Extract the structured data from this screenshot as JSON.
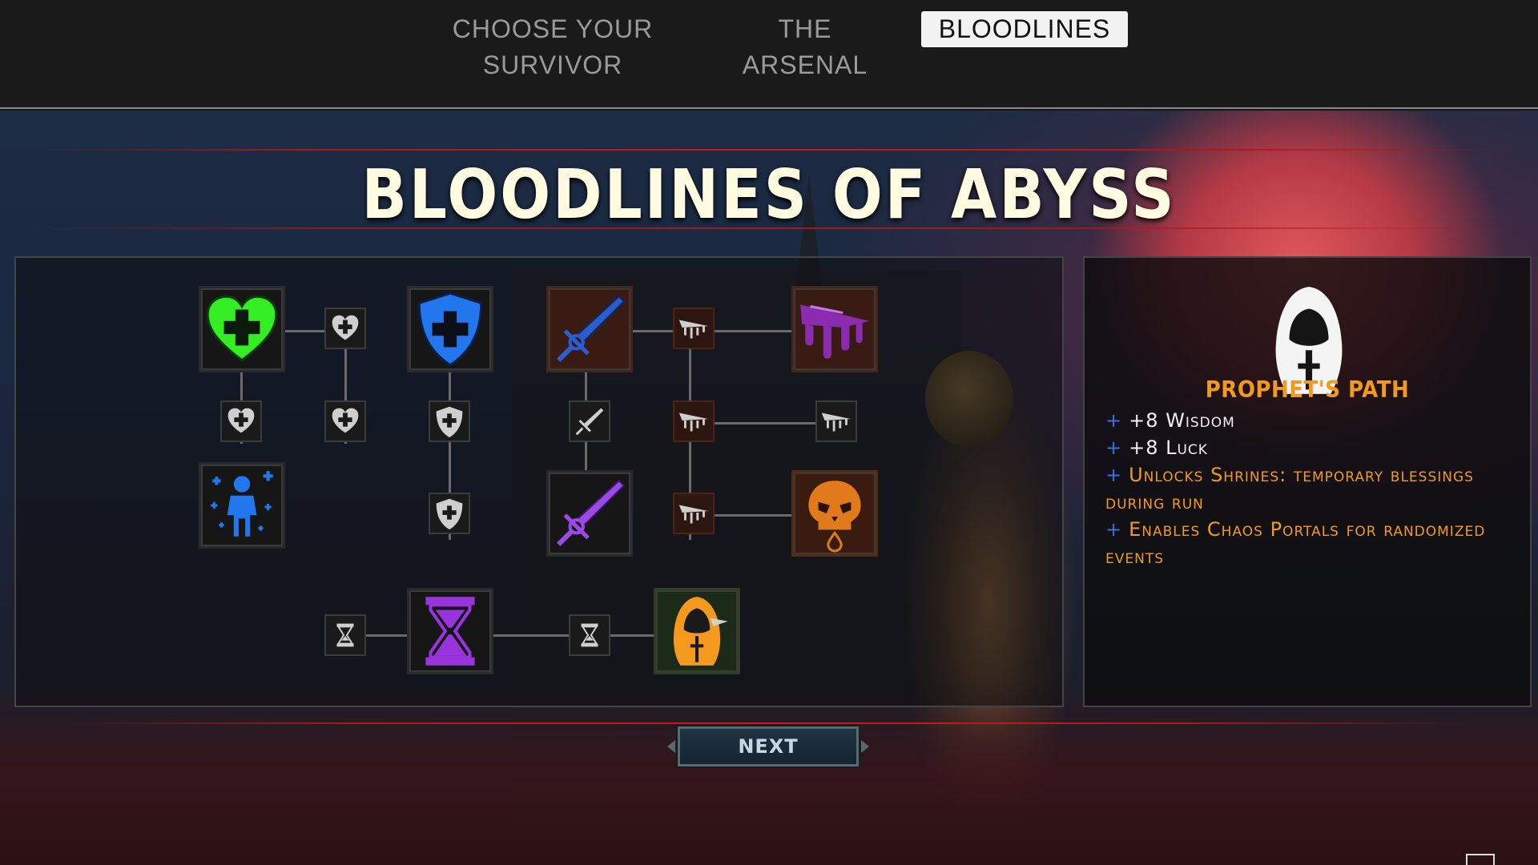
{
  "tabs": [
    {
      "label": "CHOOSE YOUR SURVIVOR",
      "active": false
    },
    {
      "label": "THE ARSENAL",
      "active": false
    },
    {
      "label": "BLOODLINES",
      "active": true
    }
  ],
  "title": "BLOODLINES OF ABYSS",
  "colors": {
    "heal_green": "#33ee22",
    "shield_blue": "#2277ee",
    "sword_purple": "#8844dd",
    "hourglass_purple": "#9933dd",
    "prophet_orange": "#f39a1e",
    "stat_plus_blue": "#3b6ee0"
  },
  "skill_tree": {
    "nodes": [
      {
        "name": "heal-heart-node",
        "icon": "green-heart-plus-icon"
      },
      {
        "name": "shield-node",
        "icon": "blue-shield-plus-icon"
      },
      {
        "name": "blue-sword-node",
        "icon": "blue-sword-icon"
      },
      {
        "name": "blood-blade-node",
        "icon": "purple-dripping-blade-icon"
      },
      {
        "name": "blessed-survivor-node",
        "icon": "blue-person-plus-icon"
      },
      {
        "name": "purple-sword-node",
        "icon": "purple-sword-icon"
      },
      {
        "name": "skull-node",
        "icon": "orange-skull-icon"
      },
      {
        "name": "hourglass-node",
        "icon": "purple-hourglass-icon"
      },
      {
        "name": "prophet-node",
        "icon": "orange-hooded-prophet-icon"
      }
    ]
  },
  "info": {
    "name": "PROPHET'S PATH",
    "icon": "hooded-prophet-icon",
    "stats": [
      {
        "prefix": "+",
        "text": "+8 Wisdom",
        "style": "white"
      },
      {
        "prefix": "+",
        "text": "+8 Luck",
        "style": "white"
      },
      {
        "prefix": "+",
        "text": "Unlocks Shrines: temporary blessings during run",
        "style": "orange"
      },
      {
        "prefix": "+",
        "text": "Enables Chaos Portals for randomized events",
        "style": "orange"
      }
    ]
  },
  "next_label": "NEXT"
}
